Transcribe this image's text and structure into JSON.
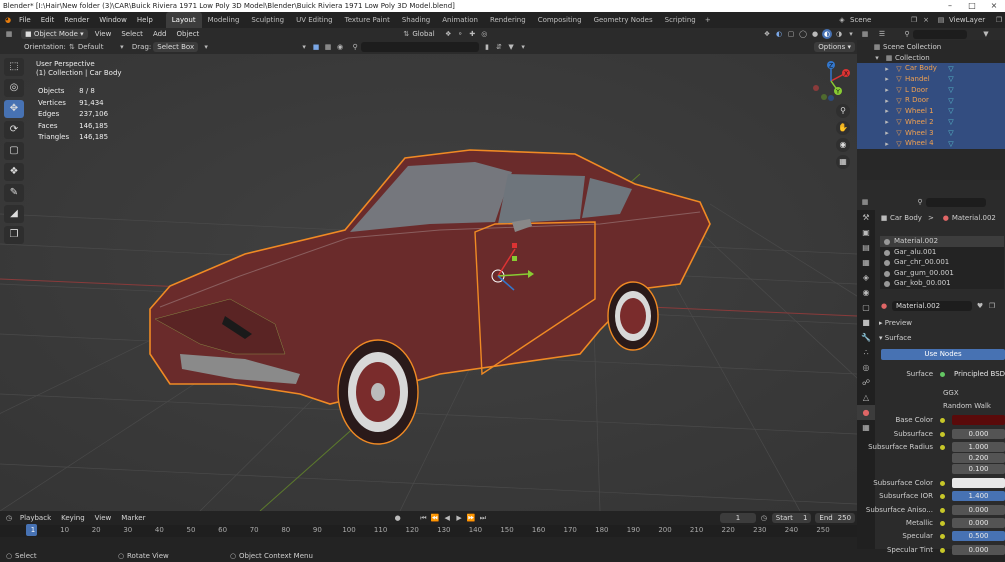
{
  "window": {
    "title": "Blender* [I:\\Hair\\New folder (3)\\CAR\\Buick Riviera 1971 Low Poly 3D Model\\Blender\\Buick Riviera 1971 Low Poly 3D Model.blend]"
  },
  "menu": [
    "File",
    "Edit",
    "Render",
    "Window",
    "Help"
  ],
  "workspaces": [
    "Layout",
    "Modeling",
    "Sculpting",
    "UV Editing",
    "Texture Paint",
    "Shading",
    "Animation",
    "Rendering",
    "Compositing",
    "Geometry Nodes",
    "Scripting"
  ],
  "active_workspace": "Layout",
  "scene": {
    "label": "Scene",
    "view_layer": "ViewLayer"
  },
  "viewport_header": {
    "mode": "Object Mode",
    "view": "View",
    "select": "Select",
    "add": "Add",
    "object": "Object",
    "transform": "Global",
    "orientation_label": "Orientation:",
    "orientation_value": "Default",
    "drag_label": "Drag:",
    "drag_value": "Select Box",
    "options": "Options"
  },
  "viewport_info": {
    "line1": "User Perspective",
    "line2": "(1) Collection | Car Body"
  },
  "stats": [
    {
      "label": "Objects",
      "value": "8 / 8"
    },
    {
      "label": "Vertices",
      "value": "91,434"
    },
    {
      "label": "Edges",
      "value": "237,106"
    },
    {
      "label": "Faces",
      "value": "146,185"
    },
    {
      "label": "Triangles",
      "value": "146,185"
    }
  ],
  "gizmo": {
    "x": "X",
    "y": "Y",
    "z": "Z"
  },
  "outliner": {
    "scene_collection": "Scene Collection",
    "collection": "Collection",
    "items": [
      "Car Body",
      "Handel",
      "L Door",
      "R Door",
      "Wheel 1",
      "Wheel 2",
      "Wheel 3",
      "Wheel 4"
    ]
  },
  "properties": {
    "object": "Car Body",
    "material": "Material.002",
    "slots": [
      "Material.002",
      "Gar_alu.001",
      "Gar_chr_00.001",
      "Gar_gum_00.001",
      "Gar_kob_00.001"
    ],
    "material_field": "Material.002",
    "preview": "Preview",
    "surface_section": "Surface",
    "use_nodes": "Use Nodes",
    "surface_label": "Surface",
    "surface_value": "Principled BSDF",
    "distribution": "GGX",
    "subsurface_method": "Random Walk",
    "rows": [
      {
        "label": "Base Color",
        "value": ""
      },
      {
        "label": "Subsurface",
        "value": "0.000"
      },
      {
        "label": "Subsurface Radius",
        "value": "1.000"
      },
      {
        "label": "",
        "value": "0.200"
      },
      {
        "label": "",
        "value": "0.100"
      },
      {
        "label": "Subsurface Color",
        "value": ""
      },
      {
        "label": "Subsurface IOR",
        "value": "1.400"
      },
      {
        "label": "Subsurface Aniso...",
        "value": "0.000"
      },
      {
        "label": "Metallic",
        "value": "0.000"
      },
      {
        "label": "Specular",
        "value": "0.500"
      },
      {
        "label": "Specular Tint",
        "value": "0.000"
      }
    ]
  },
  "timeline": {
    "playback": "Playback",
    "keying": "Keying",
    "view": "View",
    "marker": "Marker",
    "current_frame": "1",
    "start_label": "Start",
    "start": "1",
    "end_label": "End",
    "end": "250",
    "ticks": [
      "1",
      "10",
      "20",
      "30",
      "40",
      "50",
      "60",
      "70",
      "80",
      "90",
      "100",
      "110",
      "120",
      "130",
      "140",
      "150",
      "160",
      "170",
      "180",
      "190",
      "200",
      "210",
      "220",
      "230",
      "240",
      "250"
    ]
  },
  "statusbar": {
    "select": "Select",
    "rotate": "Rotate View",
    "context": "Object Context Menu"
  },
  "colors": {
    "accent": "#4772b3",
    "selection_outline": "#f08a24",
    "car_body": "#6a2b2b",
    "base_color": "#5a0a0a"
  }
}
